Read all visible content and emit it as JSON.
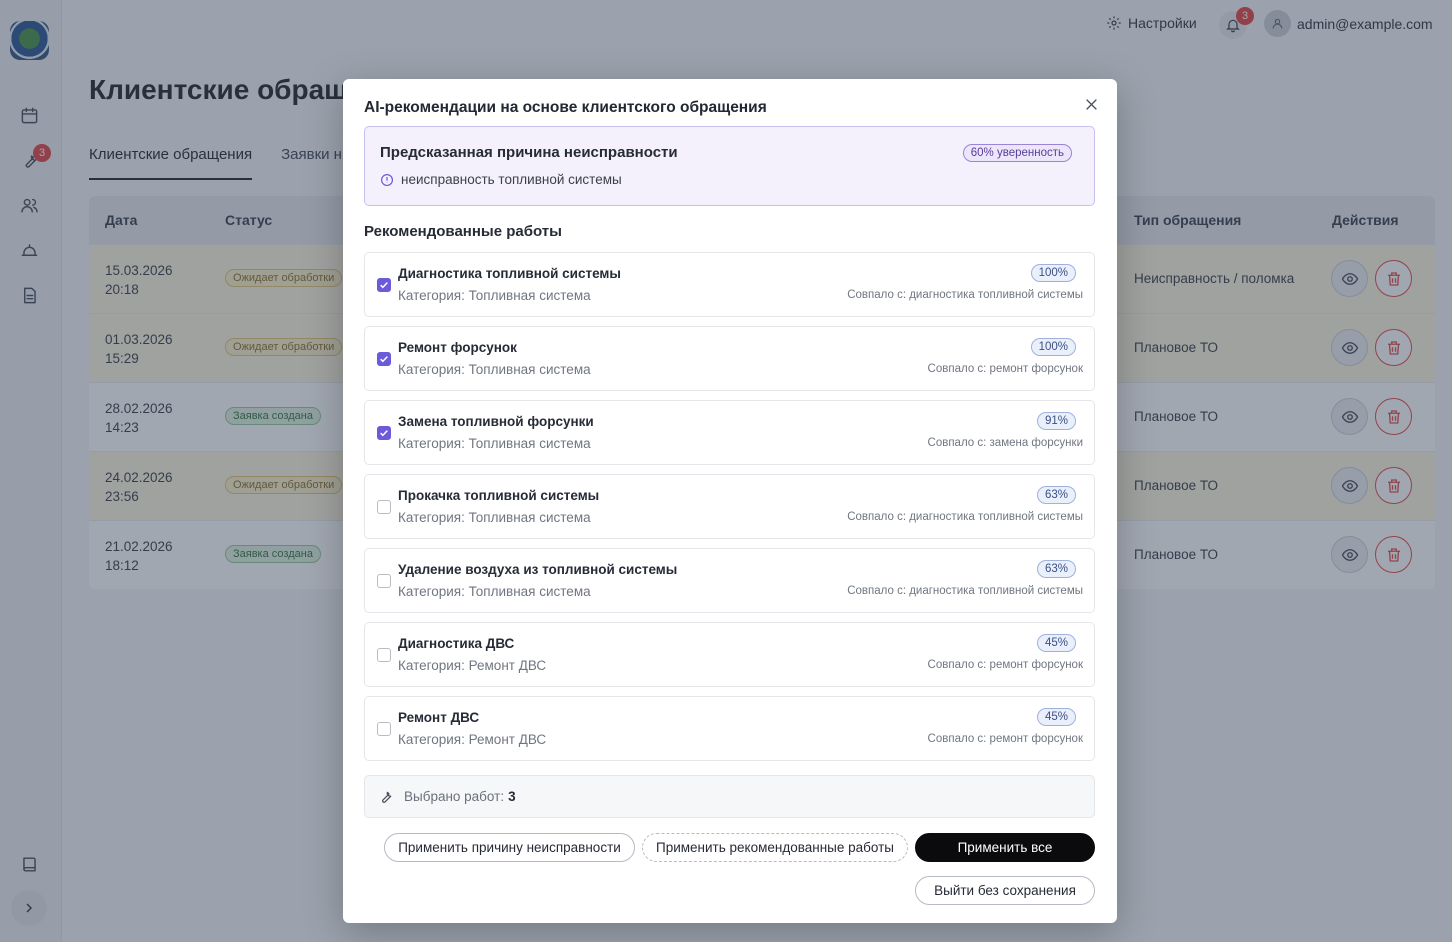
{
  "app": {
    "topbar": {
      "settings_label": "Настройки",
      "notifications_count": "3",
      "user_email": "admin@example.com"
    },
    "sidebar": {
      "badge_count": "3"
    },
    "page_title": "Клиентские обращения",
    "tabs": [
      {
        "label": "Клиентские обращения"
      },
      {
        "label": "Заявки н"
      }
    ],
    "table": {
      "headers": {
        "date": "Дата",
        "status": "Статус",
        "type": "Тип обращения",
        "actions": "Действия"
      },
      "rows": [
        {
          "date": "15.03.2026",
          "time": "20:18",
          "status": "Ожидает обработки",
          "type": "Неисправность / поломка"
        },
        {
          "date": "01.03.2026",
          "time": "15:29",
          "status": "Ожидает обработки",
          "type": "Плановое ТО"
        },
        {
          "date": "28.02.2026",
          "time": "14:23",
          "status": "Заявка создана",
          "type": "Плановое ТО"
        },
        {
          "date": "24.02.2026",
          "time": "23:56",
          "status": "Ожидает обработки",
          "type": "Плановое ТО"
        },
        {
          "date": "21.02.2026",
          "time": "18:12",
          "status": "Заявка создана",
          "type": "Плановое ТО"
        }
      ]
    }
  },
  "modal": {
    "title": "AI-рекомендации на основе клиентского обращения",
    "cause": {
      "heading": "Предсказанная причина неисправности",
      "confidence": "60% уверенность",
      "text": "неисправность топливной системы"
    },
    "recommended_title": "Рекомендованные работы",
    "recommendations": [
      {
        "name": "Диагностика топливной системы",
        "category": "Категория: Топливная система",
        "percent": "100%",
        "match": "Совпало с: диагностика топливной системы",
        "checked": true
      },
      {
        "name": "Ремонт форсунок",
        "category": "Категория: Топливная система",
        "percent": "100%",
        "match": "Совпало с: ремонт форсунок",
        "checked": true
      },
      {
        "name": "Замена топливной форсунки",
        "category": "Категория: Топливная система",
        "percent": "91%",
        "match": "Совпало с: замена форсунки",
        "checked": true
      },
      {
        "name": "Прокачка топливной системы",
        "category": "Категория: Топливная система",
        "percent": "63%",
        "match": "Совпало с: диагностика топливной системы",
        "checked": false
      },
      {
        "name": "Удаление воздуха из топливной системы",
        "category": "Категория: Топливная система",
        "percent": "63%",
        "match": "Совпало с: диагностика топливной системы",
        "checked": false
      },
      {
        "name": "Диагностика ДВС",
        "category": "Категория: Ремонт ДВС",
        "percent": "45%",
        "match": "Совпало с: ремонт форсунок",
        "checked": false
      },
      {
        "name": "Ремонт ДВС",
        "category": "Категория: Ремонт ДВС",
        "percent": "45%",
        "match": "Совпало с: ремонт форсунок",
        "checked": false
      }
    ],
    "summary": {
      "label": "Выбрано работ:",
      "count": "3"
    },
    "buttons": {
      "apply_cause": "Применить причину неисправности",
      "apply_works": "Применить рекомендованные работы",
      "apply_all": "Применить все",
      "exit": "Выйти без сохранения"
    }
  },
  "colors": {
    "accent": "#6b5bd9",
    "danger": "#e0413f",
    "pending_row": "#fdf5de"
  }
}
